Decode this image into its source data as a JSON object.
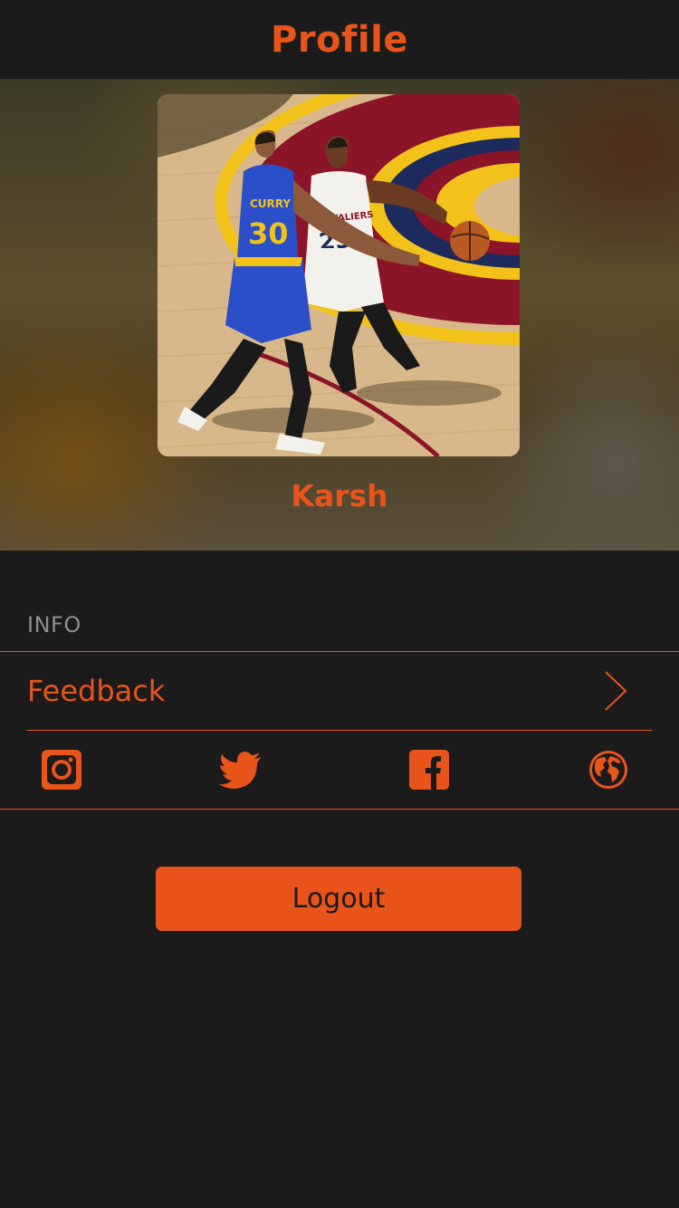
{
  "nav": {
    "title": "Profile"
  },
  "profile": {
    "name": "Karsh",
    "avatar_icon": "basketball-photo",
    "jerseys": {
      "player_one_name": "CURRY",
      "player_one_number": "30",
      "player_two_team": "CAVALIERS",
      "player_two_number": "23"
    }
  },
  "info": {
    "section_title": "INFO",
    "feedback_label": "Feedback",
    "chevron_icon": "chevron-right-icon",
    "social": [
      {
        "name": "instagram",
        "icon": "instagram-icon"
      },
      {
        "name": "twitter",
        "icon": "twitter-icon"
      },
      {
        "name": "facebook",
        "icon": "facebook-icon"
      },
      {
        "name": "website",
        "icon": "globe-icon"
      }
    ]
  },
  "actions": {
    "logout_label": "Logout"
  },
  "colors": {
    "accent": "#e8541a",
    "background": "#1b1b1b",
    "section_text": "#8e8e8e"
  }
}
